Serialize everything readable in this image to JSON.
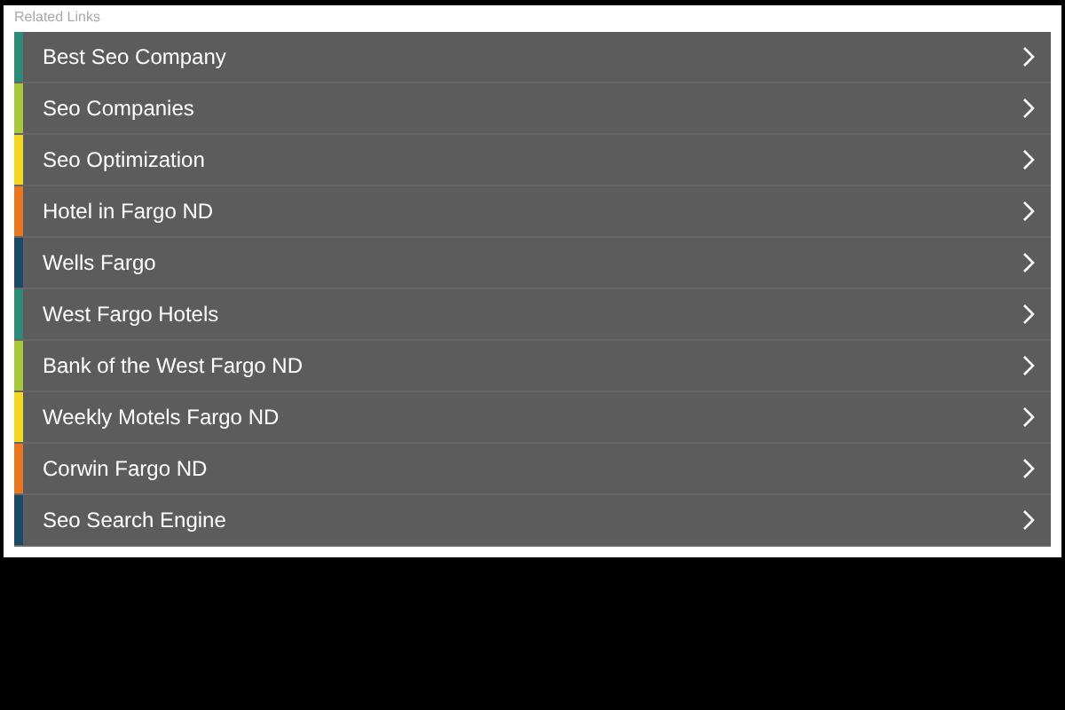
{
  "header": "Related Links",
  "links": [
    {
      "label": "Best Seo Company",
      "color": "#2a8c78"
    },
    {
      "label": "Seo Companies",
      "color": "#a8c83c"
    },
    {
      "label": "Seo Optimization",
      "color": "#f2d81e"
    },
    {
      "label": "Hotel in Fargo ND",
      "color": "#e8761e"
    },
    {
      "label": "Wells Fargo",
      "color": "#1c4a66"
    },
    {
      "label": "West Fargo Hotels",
      "color": "#2a8c78"
    },
    {
      "label": "Bank of the West Fargo ND",
      "color": "#a8c83c"
    },
    {
      "label": "Weekly Motels Fargo ND",
      "color": "#f2d81e"
    },
    {
      "label": "Corwin Fargo ND",
      "color": "#e8761e"
    },
    {
      "label": "Seo Search Engine",
      "color": "#1c4a66"
    }
  ]
}
